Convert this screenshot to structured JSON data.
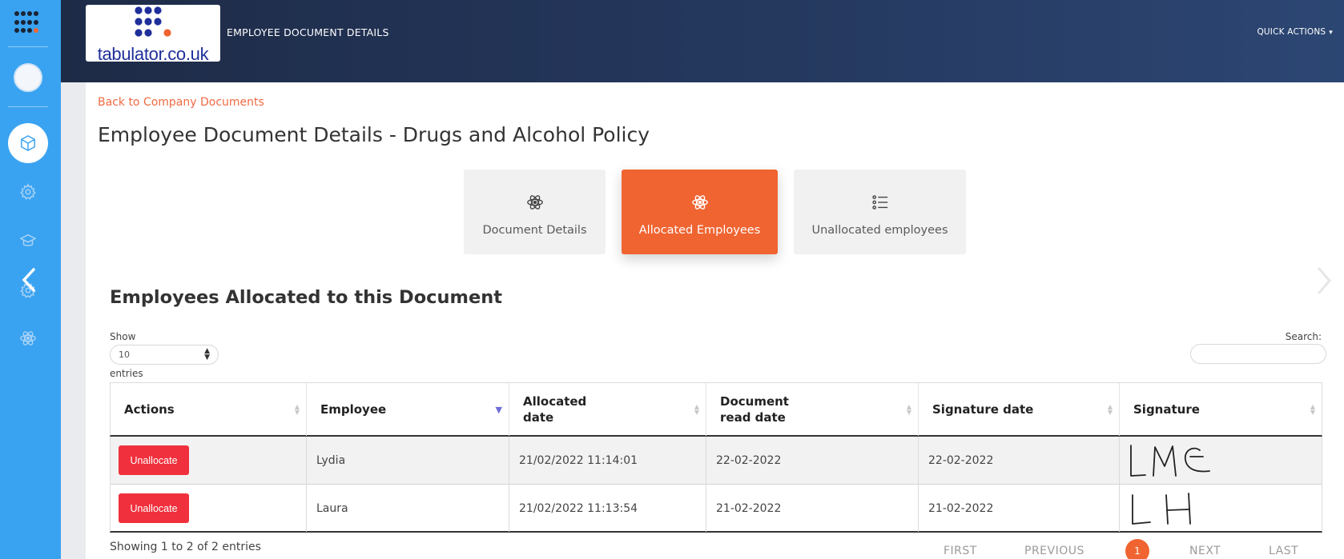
{
  "header": {
    "logo_text": "tabulator.co.uk",
    "title": "EMPLOYEE DOCUMENT DETAILS",
    "quick_actions": "QUICK ACTIONS"
  },
  "sidebar": {
    "items": [
      {
        "icon": "apps-grid-icon"
      },
      {
        "icon": "user-avatar"
      },
      {
        "icon": "cube-icon",
        "active": true
      },
      {
        "icon": "settings-icon"
      },
      {
        "icon": "graduation-cap-icon"
      },
      {
        "icon": "settings-icon"
      },
      {
        "icon": "atom-icon"
      }
    ]
  },
  "main": {
    "back_link": "Back to Company Documents",
    "title": "Employee Document Details - Drugs and Alcohol Policy",
    "tabs": [
      {
        "label": "Document Details",
        "icon": "atom-icon",
        "active": false
      },
      {
        "label": "Allocated Employees",
        "icon": "atom-icon",
        "active": true
      },
      {
        "label": "Unallocated employees",
        "icon": "list-icon",
        "active": false
      }
    ],
    "section_title": "Employees Allocated to this Document"
  },
  "table_controls": {
    "show_label": "Show",
    "page_length": "10",
    "entries_label": "entries",
    "search_label": "Search:",
    "search_value": ""
  },
  "table": {
    "columns": [
      "Actions",
      "Employee",
      "Allocated date",
      "Document read date",
      "Signature date",
      "Signature"
    ],
    "rows": [
      {
        "action": "Unallocate",
        "employee": "Lydia",
        "allocated_date": "21/02/2022 11:14:01",
        "read_date": "22-02-2022",
        "signature_date": "22-02-2022",
        "signature": "LMC"
      },
      {
        "action": "Unallocate",
        "employee": "Laura",
        "allocated_date": "21/02/2022 11:13:54",
        "read_date": "21-02-2022",
        "signature_date": "21-02-2022",
        "signature": "LH"
      }
    ],
    "info": "Showing 1 to 2 of 2 entries"
  },
  "pagination": {
    "first": "FIRST",
    "previous": "PREVIOUS",
    "current": "1",
    "next": "NEXT",
    "last": "LAST"
  },
  "colors": {
    "sidebar": "#3aa3f1",
    "header": "#1e2b47",
    "accent": "#f06431",
    "danger": "#f0303c"
  }
}
